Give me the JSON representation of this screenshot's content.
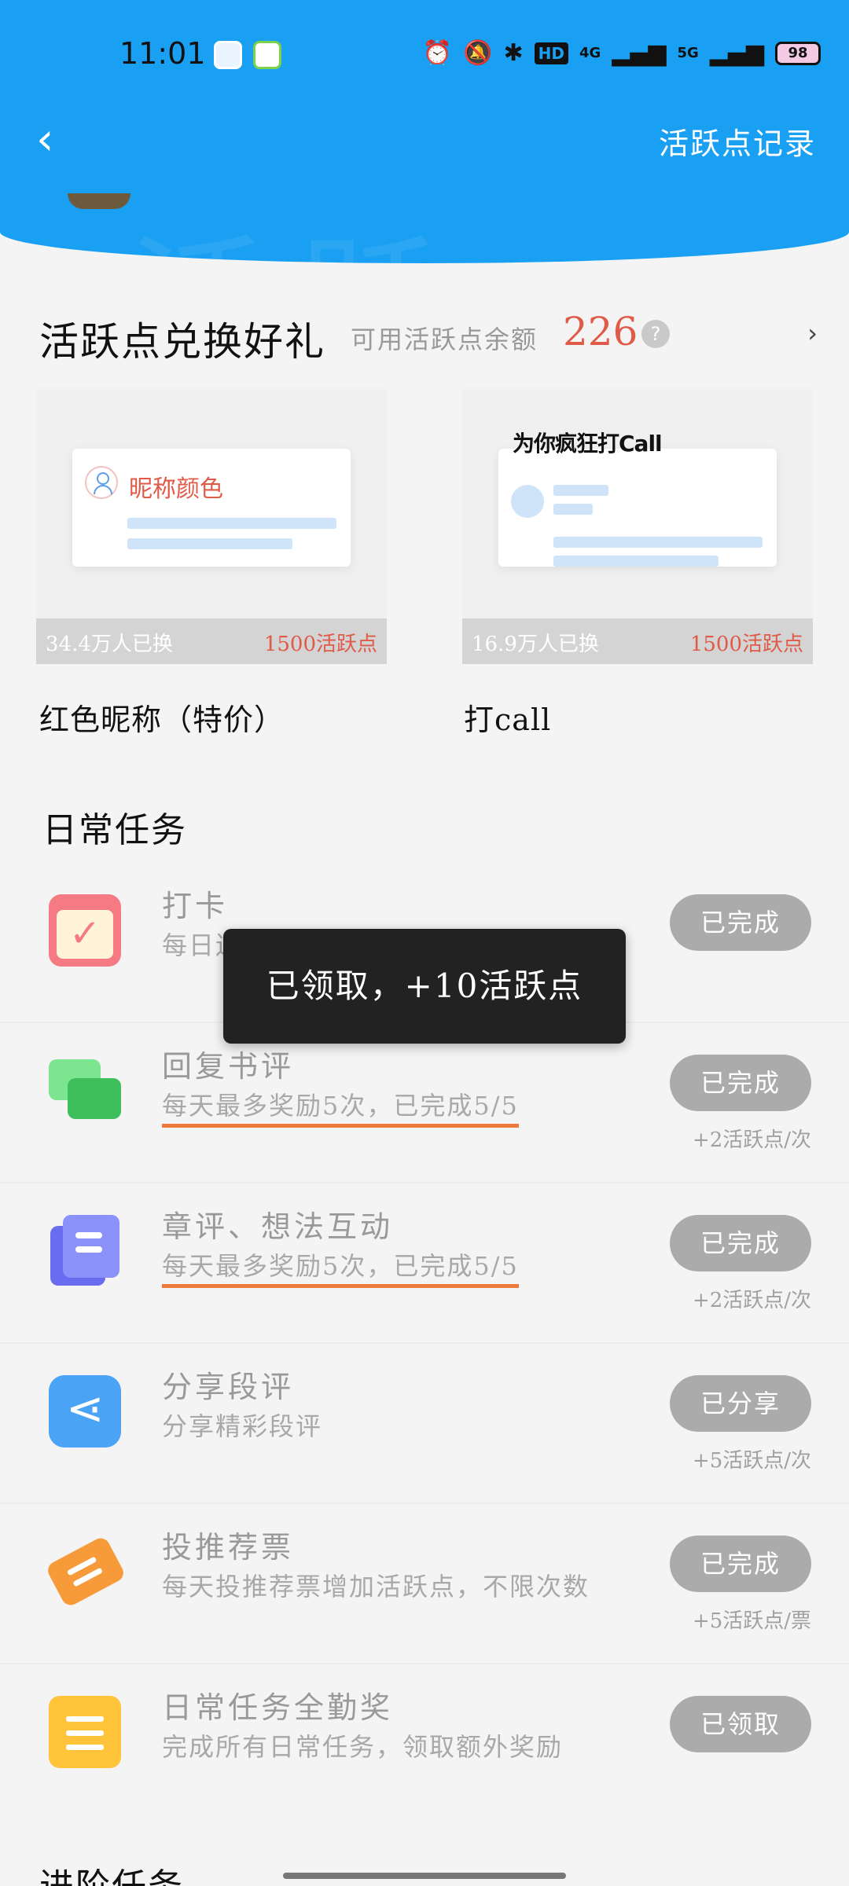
{
  "status_bar": {
    "time": "11:01",
    "hd_label": "HD",
    "net1": "4G",
    "net2": "5G",
    "battery": "98"
  },
  "header": {
    "back_icon": "chevron-left-icon",
    "record_link": "活跃点记录"
  },
  "exchange": {
    "title": "活跃点兑换好礼",
    "balance_label": "可用活跃点余额",
    "balance": "226",
    "help_icon": "?",
    "more_icon": "›",
    "items": [
      {
        "preview_label": "昵称颜色",
        "count": "34.4万人已换",
        "price": "1500活跃点",
        "name": "红色昵称（特价）"
      },
      {
        "preview_label": "为你疯狂打Call",
        "count": "16.9万人已换",
        "price": "1500活跃点",
        "name": "打call"
      }
    ]
  },
  "daily": {
    "title": "日常任务",
    "tasks": [
      {
        "name": "打卡",
        "desc": "每日连续打卡可获得更多活跃点",
        "button": "已完成",
        "reward": "",
        "icon": "calendar-icon"
      },
      {
        "name": "回复书评",
        "desc": "每天最多奖励5次，已完成5/5",
        "button": "已完成",
        "reward": "+2活跃点/次",
        "icon": "chat-bubbles-icon"
      },
      {
        "name": "章评、想法互动",
        "desc": "每天最多奖励5次，已完成5/5",
        "button": "已完成",
        "reward": "+2活跃点/次",
        "icon": "document-icon"
      },
      {
        "name": "分享段评",
        "desc": "分享精彩段评",
        "button": "已分享",
        "reward": "+5活跃点/次",
        "icon": "share-icon"
      },
      {
        "name": "投推荐票",
        "desc": "每天投推荐票增加活跃点，不限次数",
        "button": "已完成",
        "reward": "+5活跃点/票",
        "icon": "ticket-icon"
      },
      {
        "name": "日常任务全勤奖",
        "desc": "完成所有日常任务，领取额外奖励",
        "button": "已领取",
        "reward": "",
        "icon": "list-icon"
      }
    ]
  },
  "advanced": {
    "title": "进阶任务"
  },
  "toast": {
    "text": "已领取，+10活跃点"
  }
}
